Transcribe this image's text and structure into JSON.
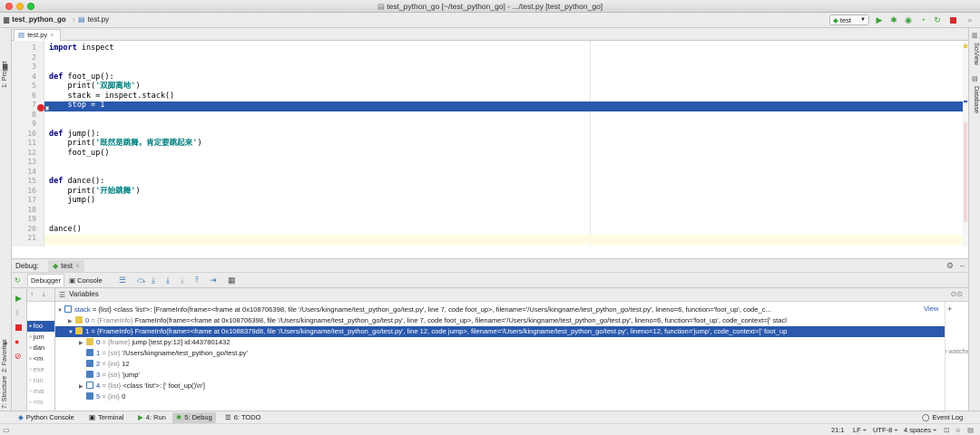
{
  "window": {
    "title": "test_python_go [~/test_python_go] - .../test.py [test_python_go]"
  },
  "navbar": {
    "project": "test_python_go",
    "file": "test.py",
    "run_config": "test"
  },
  "left_strip": {
    "project": "1: Project",
    "favorites": "2: Favorites",
    "structure": "7: Structure"
  },
  "right_strip": {
    "sciview": "SciView",
    "database": "Database"
  },
  "editor": {
    "tab": "test.py",
    "line_numbers": [
      "1",
      "2",
      "3",
      "4",
      "5",
      "6",
      "7",
      "8",
      "9",
      "10",
      "11",
      "12",
      "13",
      "14",
      "15",
      "16",
      "17",
      "18",
      "19",
      "20",
      "21"
    ],
    "lines": {
      "l1a": "import",
      "l1b": " inspect",
      "l4a": "def",
      "l4b": " foot_up():",
      "l5a": "    print(",
      "l5b": "'双脚离地'",
      "l5c": ")",
      "l6": "    stack = inspect.stack()",
      "l7": "    stop = 1",
      "l10a": "def",
      "l10b": " jump():",
      "l11a": "    print(",
      "l11b": "'既然是跳舞，肯定要跳起来'",
      "l11c": ")",
      "l12": "    foot_up()",
      "l15a": "def",
      "l15b": " dance():",
      "l16a": "    print(",
      "l16b": "'开始跳舞'",
      "l16c": ")",
      "l17": "    jump()",
      "l20": "dance()"
    },
    "execution_line": 7,
    "breakpoint_line": 7
  },
  "debug": {
    "label": "Debug:",
    "session": "test",
    "tab_debugger": "Debugger",
    "tab_console": "Console",
    "variables_label": "Variables",
    "frames": [
      "foo",
      "jum",
      "dan",
      "<m",
      "exe",
      "run",
      "mai",
      "<m"
    ],
    "vars": {
      "r0a": "stack",
      "r0b": " = {list} ",
      "r0c": "<class 'list'>: [FrameInfo(frame=<frame at 0x108706398, file '/Users/kingname/test_python_go/test.py', line 7, code foot_up>, filename='/Users/kingname/test_python_go/test.py', lineno=6, function='foot_up', code_c...",
      "r0view": "View",
      "r1a": "0",
      "r1b": " = {FrameInfo} ",
      "r1c": "FrameInfo(frame=<frame at 0x108706398, file '/Users/kingname/test_python_go/test.py', line 7, code foot_up>, filename='/Users/kingname/test_python_go/test.py', lineno=6, function='foot_up', code_context=['    stacl",
      "r2": "1 = {FrameInfo} FrameInfo(frame=<frame at 0x1088379d8, file '/Users/kingname/test_python_go/test.py', line 12, code jump>, filename='/Users/kingname/test_python_go/test.py', lineno=12, function='jump', code_context=['    foot_up",
      "r3a": "0",
      "r3b": " = {frame} ",
      "r3c": "jump [test.py:12]  id:4437801432",
      "r4a": "1",
      "r4b": " = {str} ",
      "r4c": "'/Users/kingname/test_python_go/test.py'",
      "r5a": "2",
      "r5b": " = {int} ",
      "r5c": "12",
      "r6a": "3",
      "r6b": " = {str} ",
      "r6c": "'jump'",
      "r7a": "4",
      "r7b": " = {list} ",
      "r7c": "<class 'list'>: ['    foot_up()\\n']",
      "r8a": "5",
      "r8b": " = {int} ",
      "r8c": "0"
    },
    "watches_text": "o watche"
  },
  "bottom_tools": {
    "python_console": "Python Console",
    "terminal": "Terminal",
    "run": "4: Run",
    "debug": "5: Debug",
    "todo": "6: TODO",
    "event_log": "Event Log"
  },
  "status": {
    "position": "21:1",
    "line_sep": "LF ÷",
    "encoding": "UTF-8 ÷",
    "indent": "4 spaces ÷"
  },
  "colors": {
    "selection": "#2a58ad",
    "breakpoint": "#e0262a",
    "run_green": "#3c9e36"
  }
}
